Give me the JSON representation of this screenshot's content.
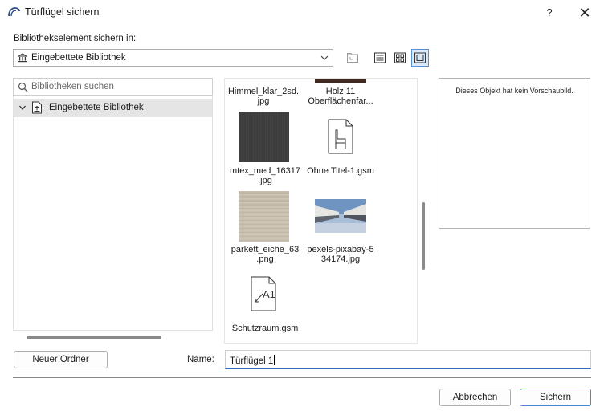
{
  "window": {
    "title": "Türflügel sichern",
    "help_label": "?",
    "close_label": "✕",
    "logo_icon": "archicad-logo-icon"
  },
  "location": {
    "label": "Bibliothekselement sichern in:",
    "selected": "Eingebettete Bibliothek"
  },
  "toolbar": {
    "icons": [
      "new-folder-icon",
      "list-view-icon",
      "icon-view-icon",
      "preview-view-icon"
    ],
    "active_view": "preview-view-icon"
  },
  "search": {
    "placeholder": "Bibliotheken suchen"
  },
  "tree": {
    "items": [
      {
        "label": "Eingebettete Bibliothek",
        "expanded": true,
        "selected": true
      }
    ]
  },
  "files": [
    {
      "name_line1": "Himmel_klar_2sd.",
      "name_line2": "jpg",
      "thumb": "sky-image"
    },
    {
      "name_line1": "Holz 11",
      "name_line2": "Oberflächenfar...",
      "thumb": "wood-texture"
    },
    {
      "name_line1": "mtex_med_16317",
      "name_line2": ".jpg",
      "thumb": "dark-fabric-texture"
    },
    {
      "name_line1": "Ohne Titel-1.gsm",
      "name_line2": "",
      "thumb": "chair-document-icon"
    },
    {
      "name_line1": "parkett_eiche_63",
      "name_line2": ".png",
      "thumb": "oak-parquet-texture"
    },
    {
      "name_line1": "pexels-pixabay-5",
      "name_line2": "34174.jpg",
      "thumb": "building-photo"
    },
    {
      "name_line1": "Schutzraum.gsm",
      "name_line2": "",
      "thumb": "a1-document-icon"
    }
  ],
  "preview": {
    "text": "Dieses Objekt hat kein Vorschaubild."
  },
  "buttons": {
    "new_folder": "Neuer Ordner",
    "cancel": "Abbrechen",
    "save": "Sichern"
  },
  "name_field": {
    "label": "Name:",
    "value": "Türflügel 1"
  },
  "colors": {
    "accent": "#2f6cc4",
    "selection": "#e5e5e5"
  }
}
